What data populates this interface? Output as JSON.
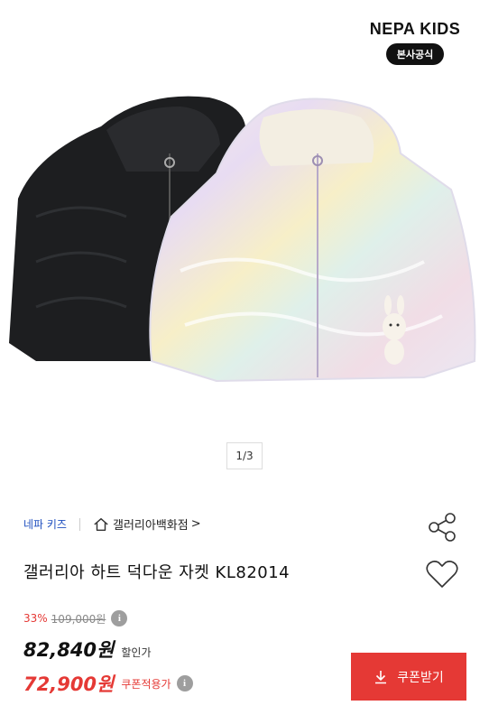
{
  "brand": {
    "logo_text": "NEPA KIDS",
    "badge": "본사공식"
  },
  "gallery": {
    "pager": "1/3"
  },
  "breadcrumb": {
    "brand": "네파 키즈",
    "store": "갤러리아백화점",
    "store_chevron": ">"
  },
  "product": {
    "title": "갤러리아 하트 덕다운 자켓 KL82014"
  },
  "price": {
    "discount_rate": "33%",
    "original_price": "109,000원",
    "sale_price": "82,840원",
    "sale_label": "할인가",
    "coupon_price": "72,900원",
    "coupon_label": "쿠폰적용가",
    "info_symbol": "i"
  },
  "actions": {
    "coupon_button": "쿠폰받기"
  },
  "icons": {
    "share": "share-icon",
    "heart": "heart-icon",
    "home": "home-icon",
    "download": "download-icon",
    "info": "info-icon"
  },
  "colors": {
    "accent_red": "#e53935",
    "brand_blue": "#1f4fbf",
    "badge_black": "#111111"
  }
}
